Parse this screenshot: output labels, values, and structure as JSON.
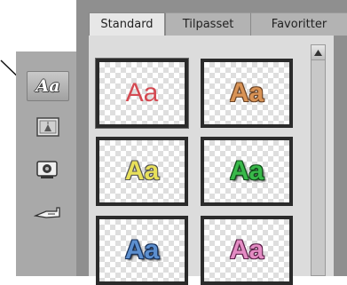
{
  "tabs": [
    {
      "label": "Standard",
      "selected": true
    },
    {
      "label": "Tilpasset",
      "selected": false
    },
    {
      "label": "Favoritter",
      "selected": false
    }
  ],
  "toolbar": {
    "items": [
      {
        "name": "title-style-tool",
        "icon": "text-style-icon",
        "label": "Aa",
        "active": true
      },
      {
        "name": "image-tool",
        "icon": "picture-icon",
        "active": false
      },
      {
        "name": "camera-tool",
        "icon": "camera-icon",
        "active": false
      },
      {
        "name": "pointer-tool",
        "icon": "hand-pointer-icon",
        "active": false
      }
    ]
  },
  "styles": [
    {
      "text": "Aa",
      "color": "#d44a52"
    },
    {
      "text": "Aa",
      "color": "#d99355"
    },
    {
      "text": "Aa",
      "color": "#e8e05a"
    },
    {
      "text": "Aa",
      "color": "#39b94a"
    },
    {
      "text": "Aa",
      "color": "#5c8fcf"
    },
    {
      "text": "Aa",
      "color": "#e48cc4"
    }
  ],
  "scrollbar": {
    "up_icon": "arrow-up-icon"
  }
}
